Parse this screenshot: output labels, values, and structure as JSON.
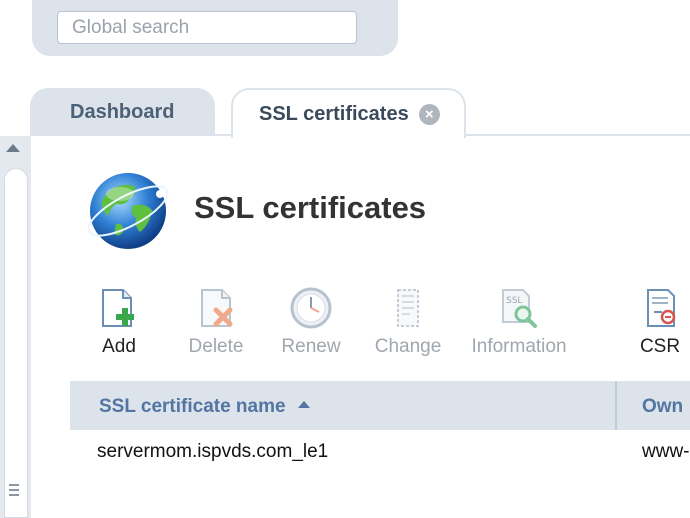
{
  "search": {
    "placeholder": "Global search"
  },
  "tabs": [
    {
      "label": "Dashboard"
    },
    {
      "label": "SSL certificates"
    }
  ],
  "page": {
    "title": "SSL certificates"
  },
  "toolbar": [
    {
      "label": "Add",
      "icon": "add-document-icon",
      "enabled": true
    },
    {
      "label": "Delete",
      "icon": "delete-document-icon",
      "enabled": false
    },
    {
      "label": "Renew",
      "icon": "clock-icon",
      "enabled": false
    },
    {
      "label": "Change",
      "icon": "edit-document-icon",
      "enabled": false
    },
    {
      "label": "Information",
      "icon": "info-search-icon",
      "enabled": false
    },
    {
      "label": "CSR",
      "icon": "csr-document-icon",
      "enabled": true
    }
  ],
  "table": {
    "columns": [
      "SSL certificate name",
      "Own"
    ],
    "sort": "ascending",
    "rows": [
      {
        "name": "servermom.ispvds.com_le1",
        "owner": "www-"
      }
    ]
  },
  "colors": {
    "header_bg": "#dde3eb",
    "header_text": "#5275a2",
    "accent_green": "#3aa84a"
  }
}
